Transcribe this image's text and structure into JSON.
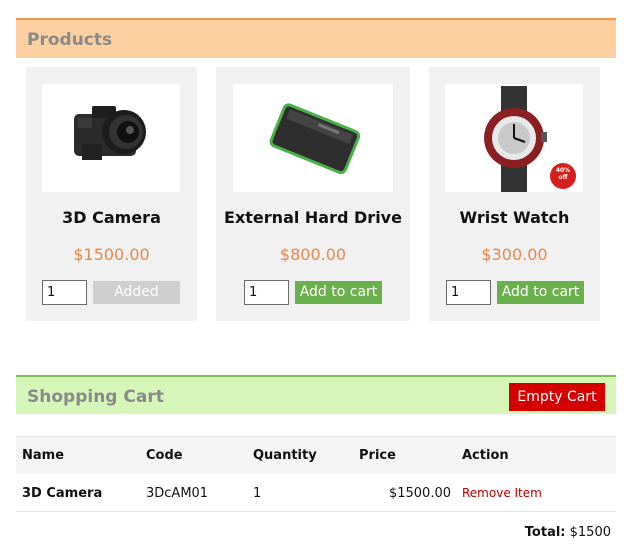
{
  "products": {
    "title": "Products",
    "items": [
      {
        "name": "3D Camera",
        "price": "$1500.00",
        "qty": "1",
        "button": "Added",
        "state": "added"
      },
      {
        "name": "External Hard Drive",
        "price": "$800.00",
        "qty": "1",
        "button": "Add to cart",
        "state": "add"
      },
      {
        "name": "Wrist Watch",
        "price": "$300.00",
        "qty": "1",
        "button": "Add to cart",
        "state": "add",
        "badge": "40% off"
      }
    ]
  },
  "cart": {
    "title": "Shopping Cart",
    "empty_label": "Empty Cart",
    "columns": [
      "Name",
      "Code",
      "Quantity",
      "Price",
      "Action"
    ],
    "rows": [
      {
        "name": "3D Camera",
        "code": "3DcAM01",
        "quantity": "1",
        "price": "$1500.00",
        "action": "Remove Item"
      }
    ],
    "total_label": "Total:",
    "total_value": "$1500"
  },
  "colors": {
    "products_header_bg": "#fdd0a2",
    "cart_header_bg": "#d6f5b9",
    "add_button": "#6ab04c",
    "added_button": "#cfcfcf",
    "empty_button": "#d40000",
    "price_text": "#e8894b"
  }
}
